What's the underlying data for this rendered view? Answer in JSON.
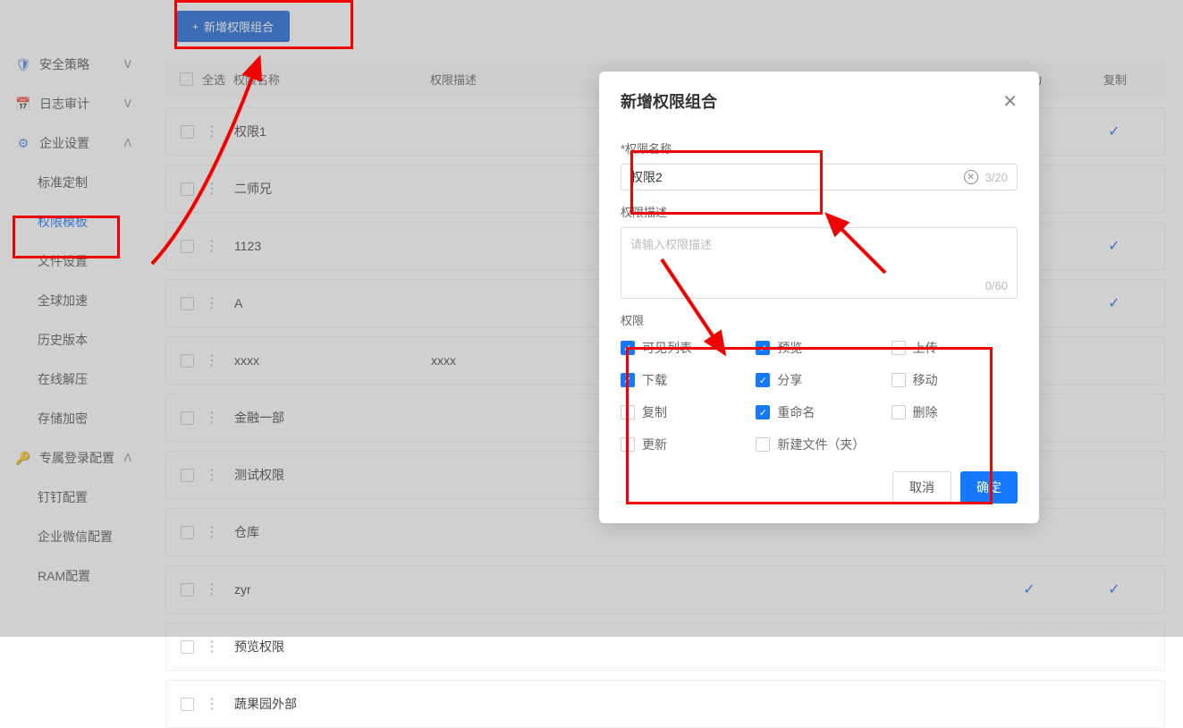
{
  "sidebar": {
    "items": [
      {
        "label": "安全策略",
        "icon": "shield"
      },
      {
        "label": "日志审计",
        "icon": "calendar"
      },
      {
        "label": "企业设置",
        "icon": "gear",
        "expanded": true,
        "children": [
          {
            "label": "标准定制"
          },
          {
            "label": "权限模板",
            "active": true
          },
          {
            "label": "文件设置"
          },
          {
            "label": "全球加速"
          },
          {
            "label": "历史版本"
          },
          {
            "label": "在线解压"
          },
          {
            "label": "存储加密"
          }
        ]
      },
      {
        "label": "专属登录配置",
        "icon": "key",
        "expanded": true,
        "children": [
          {
            "label": "钉钉配置"
          },
          {
            "label": "企业微信配置"
          },
          {
            "label": "RAM配置"
          }
        ]
      }
    ]
  },
  "toolbar": {
    "add_label": "新增权限组合"
  },
  "table": {
    "head": {
      "all": "全选",
      "name": "权限名称",
      "desc": "权限描述",
      "move": "移动",
      "copy": "复制"
    },
    "rows": [
      {
        "name": "权限1",
        "desc": "",
        "move": true,
        "copy": true
      },
      {
        "name": "二师兄",
        "desc": "",
        "move": false,
        "copy": false
      },
      {
        "name": "1123",
        "desc": "",
        "move": true,
        "copy": true
      },
      {
        "name": "A",
        "desc": "",
        "move": false,
        "copy": true
      },
      {
        "name": "xxxx",
        "desc": "xxxx",
        "move": true,
        "copy": false
      },
      {
        "name": "金融一部",
        "desc": "",
        "move": false,
        "copy": false
      },
      {
        "name": "测试权限",
        "desc": "",
        "move": false,
        "copy": false
      },
      {
        "name": "仓库",
        "desc": "",
        "move": false,
        "copy": false
      },
      {
        "name": "zyr",
        "desc": "",
        "move": true,
        "copy": true
      },
      {
        "name": "预览权限",
        "desc": "",
        "move": false,
        "copy": false
      },
      {
        "name": "蔬果园外部",
        "desc": "",
        "move": false,
        "copy": false
      }
    ]
  },
  "modal": {
    "title": "新增权限组合",
    "name_label": "权限名称",
    "name_value": "权限2",
    "name_count": "3/20",
    "desc_label": "权限描述",
    "desc_placeholder": "请输入权限描述",
    "desc_count": "0/60",
    "perm_label": "权限",
    "perms": [
      {
        "label": "可见列表",
        "checked": true
      },
      {
        "label": "预览",
        "checked": true
      },
      {
        "label": "上传",
        "checked": false
      },
      {
        "label": "下载",
        "checked": true
      },
      {
        "label": "分享",
        "checked": true
      },
      {
        "label": "移动",
        "checked": false
      },
      {
        "label": "复制",
        "checked": false
      },
      {
        "label": "重命名",
        "checked": true
      },
      {
        "label": "删除",
        "checked": false
      },
      {
        "label": "更新",
        "checked": false
      },
      {
        "label": "新建文件（夹）",
        "checked": false
      }
    ],
    "cancel": "取消",
    "ok": "确定"
  },
  "watermark": "CSDN @csdn565973850"
}
